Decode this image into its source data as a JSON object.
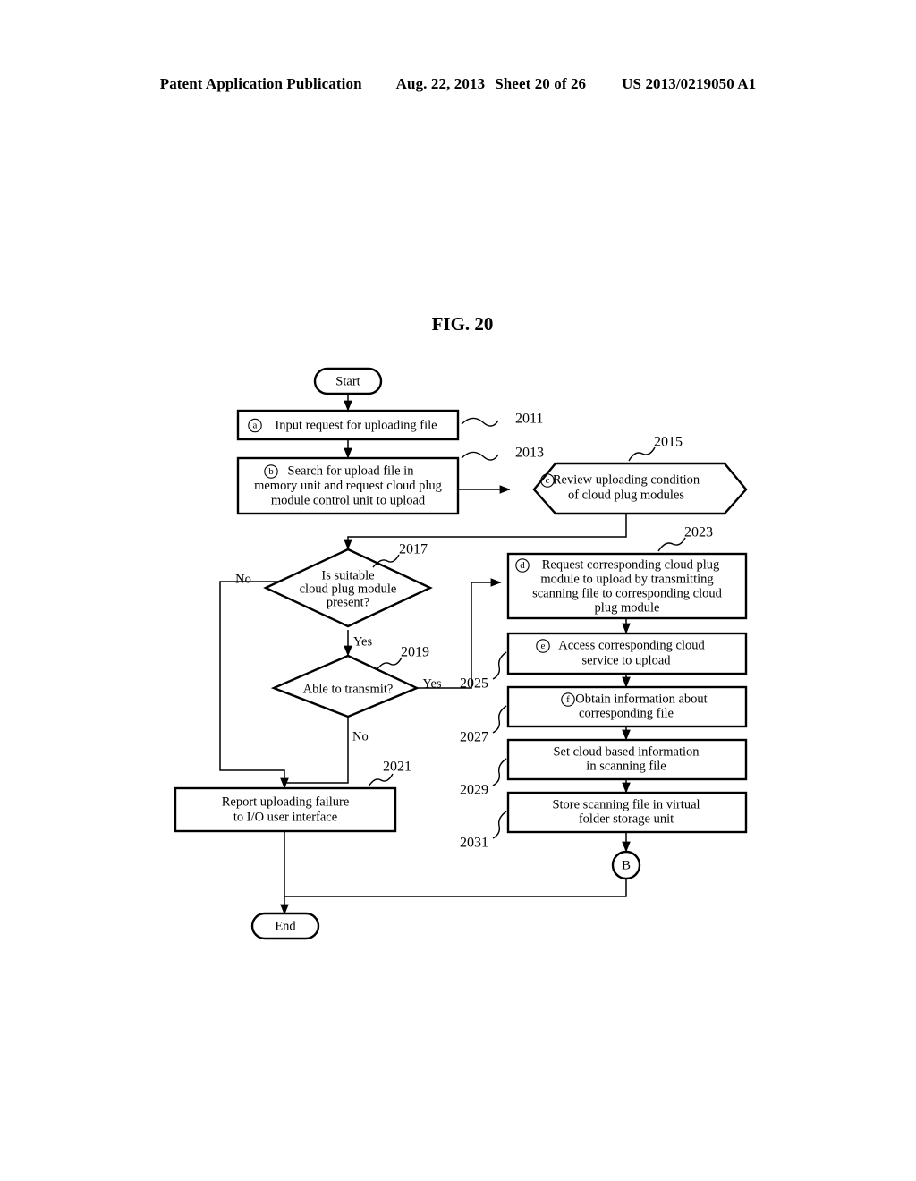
{
  "header": {
    "publication": "Patent Application Publication",
    "date": "Aug. 22, 2013",
    "sheet": "Sheet 20 of 26",
    "patent_number": "US 2013/0219050 A1"
  },
  "figure": {
    "title": "FIG. 20"
  },
  "flowchart": {
    "terminators": {
      "start": "Start",
      "end": "End"
    },
    "connector": {
      "label": "B"
    },
    "nodes": [
      {
        "id": "n2011",
        "marker": "a",
        "ref": "2011",
        "shape": "process",
        "lines": [
          "Input request for uploading file"
        ]
      },
      {
        "id": "n2013",
        "marker": "b",
        "ref": "2013",
        "shape": "process",
        "lines": [
          "Search for upload file in",
          "memory unit and request cloud plug",
          "module control unit to upload"
        ]
      },
      {
        "id": "n2015",
        "marker": "c",
        "ref": "2015",
        "shape": "hexagon",
        "lines": [
          "Review uploading condition",
          "of cloud plug modules"
        ]
      },
      {
        "id": "n2017",
        "marker": "",
        "ref": "2017",
        "shape": "decision",
        "lines": [
          "Is suitable",
          "cloud plug module",
          "present?"
        ]
      },
      {
        "id": "n2019",
        "marker": "",
        "ref": "2019",
        "shape": "decision",
        "lines": [
          "Able to transmit?"
        ]
      },
      {
        "id": "n2021",
        "marker": "",
        "ref": "2021",
        "shape": "process",
        "lines": [
          "Report uploading failure",
          "to I/O user interface"
        ]
      },
      {
        "id": "n2023",
        "marker": "d",
        "ref": "2023",
        "shape": "process",
        "lines": [
          "Request corresponding cloud plug",
          "module to upload by transmitting",
          "scanning file to corresponding cloud",
          "plug module"
        ]
      },
      {
        "id": "n2025",
        "marker": "e",
        "ref": "2025",
        "shape": "process",
        "lines": [
          "Access corresponding cloud",
          "service to upload"
        ]
      },
      {
        "id": "n2027",
        "marker": "f",
        "ref": "2027",
        "shape": "process",
        "lines": [
          "Obtain information about",
          "corresponding file"
        ]
      },
      {
        "id": "n2029",
        "marker": "",
        "ref": "2029",
        "shape": "process",
        "lines": [
          "Set cloud based information",
          "in scanning file"
        ]
      },
      {
        "id": "n2031",
        "marker": "",
        "ref": "2031",
        "shape": "process",
        "lines": [
          "Store scanning file in virtual",
          "folder storage unit"
        ]
      }
    ],
    "branch_labels": {
      "d2017_no": "No",
      "d2017_yes": "Yes",
      "d2019_yes": "Yes",
      "d2019_no": "No"
    }
  }
}
